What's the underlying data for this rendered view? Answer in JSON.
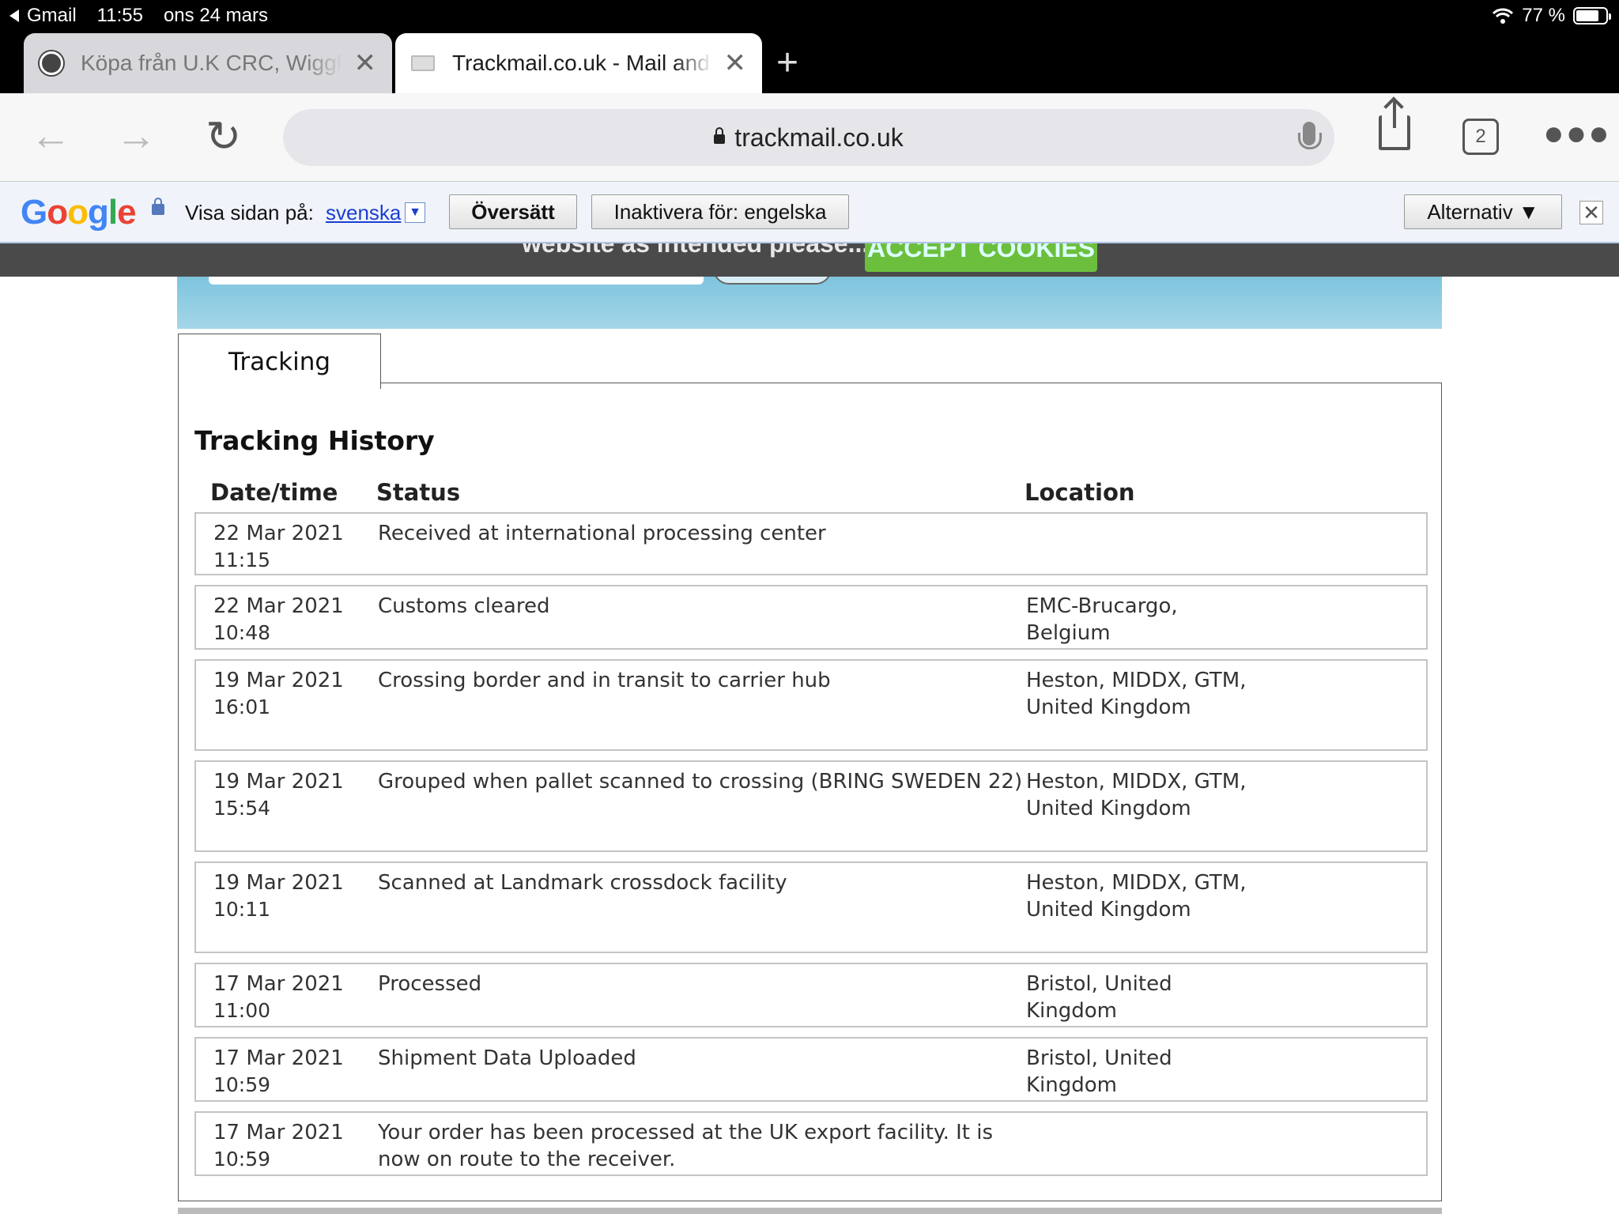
{
  "statusbar": {
    "back_app": "Gmail",
    "time": "11:55",
    "date": "ons 24 mars",
    "battery": "77 %",
    "battery_level": 0.77
  },
  "tabs": [
    {
      "title": "Köpa från U.K CRC, Wiggle",
      "close": "✕"
    },
    {
      "title": "Trackmail.co.uk - Mail and",
      "close": "✕"
    }
  ],
  "new_tab": "+",
  "toolbar": {
    "url": "trackmail.co.uk",
    "tab_count": "2"
  },
  "translate": {
    "prompt": "Visa sidan på:",
    "language": "svenska",
    "translate_label": "Översätt",
    "disable_label": "Inaktivera för: engelska",
    "options_label": "Alternativ ▼",
    "close": "✕"
  },
  "cookie": {
    "text": "website as intended please...",
    "button": "ACCEPT COOKIES"
  },
  "panel": {
    "tab_label": "Tracking",
    "title": "Tracking History",
    "columns": [
      "Date/time",
      "Status",
      "Location"
    ],
    "rows": [
      {
        "date": "22 Mar 2021",
        "time": "11:15",
        "status": "Received at international processing center",
        "location": ""
      },
      {
        "date": "22 Mar 2021",
        "time": "10:48",
        "status": "Customs cleared",
        "location": "EMC-Brucargo, Belgium"
      },
      {
        "date": "19 Mar 2021",
        "time": "16:01",
        "status": "Crossing border and in transit to carrier hub",
        "location": "Heston, MIDDX, GTM, United Kingdom"
      },
      {
        "date": "19 Mar 2021",
        "time": "15:54",
        "status": "Grouped when pallet scanned to crossing (BRING SWEDEN 22)",
        "location": "Heston, MIDDX, GTM, United Kingdom"
      },
      {
        "date": "19 Mar 2021",
        "time": "10:11",
        "status": "Scanned at Landmark crossdock facility",
        "location": "Heston, MIDDX, GTM, United Kingdom"
      },
      {
        "date": "17 Mar 2021",
        "time": "11:00",
        "status": "Processed",
        "location": "Bristol, United Kingdom"
      },
      {
        "date": "17 Mar 2021",
        "time": "10:59",
        "status": "Shipment Data Uploaded",
        "location": "Bristol, United Kingdom"
      },
      {
        "date": "17 Mar 2021",
        "time": "10:59",
        "status": "Your order has been processed at the UK export facility. It is now on route to the receiver.",
        "location": ""
      }
    ]
  }
}
